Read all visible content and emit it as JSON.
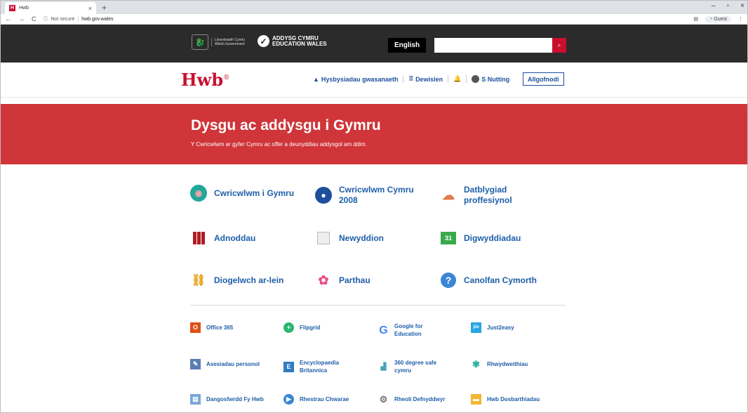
{
  "browser": {
    "tab_title": "Hwb",
    "tab_close": "×",
    "new_tab": "+",
    "security": "Not secure",
    "url": "hwb.gov.wales",
    "profile": "Guest"
  },
  "govbar": {
    "gov_line1": "Llywodraeth Cymru",
    "gov_line2": "Welsh Government",
    "edu_line1": "ADDYSG CYMRU",
    "edu_line2": "EDUCATION WALES",
    "language_button": "English",
    "search_placeholder": ""
  },
  "hwb": {
    "logo": "Hwb",
    "nav": {
      "notices": "Hysbysiadau gwasanaeth",
      "menu": "Dewislen",
      "user": "S Nutting",
      "logout": "Allgofnodi"
    }
  },
  "hero": {
    "title": "Dysgu ac addysgu i Gymru",
    "subtitle": "Y Cwricwlwm ar gyfer Cymru ac offer a deunyddiau addysgol am ddim."
  },
  "tiles": [
    {
      "label": "Cwricwlwm i Gymru",
      "icon": "brain-icon"
    },
    {
      "label": "Cwricwlwm Cymru 2008",
      "icon": "lightbulb-icon"
    },
    {
      "label": "Datblygiad proffesiynol",
      "icon": "cloud-ladder-icon"
    },
    {
      "label": "Adnoddau",
      "icon": "books-icon"
    },
    {
      "label": "Newyddion",
      "icon": "newspaper-icon"
    },
    {
      "label": "Digwyddiadau",
      "icon": "calendar-icon"
    },
    {
      "label": "Diogelwch ar-lein",
      "icon": "safety-icon"
    },
    {
      "label": "Parthau",
      "icon": "pinwheel-icon"
    },
    {
      "label": "Canolfan Cymorth",
      "icon": "help-icon"
    }
  ],
  "calendar_day": "31",
  "tools": [
    {
      "label": "Office 365",
      "icon": "office-icon"
    },
    {
      "label": "Flipgrid",
      "icon": "flipgrid-icon"
    },
    {
      "label": "Google for Education",
      "icon": "google-icon"
    },
    {
      "label": "Just2easy",
      "icon": "j2e-icon"
    },
    {
      "label": "Asesiadau personol",
      "icon": "assessment-icon"
    },
    {
      "label": "Encyclopaedia Britannica",
      "icon": "britannica-icon"
    },
    {
      "label": "360 degree safe cymru",
      "icon": "360-safe-icon"
    },
    {
      "label": "Rhwydweithiau",
      "icon": "network-icon"
    },
    {
      "label": "Dangosfwrdd Fy Hwb",
      "icon": "dashboard-icon"
    },
    {
      "label": "Rhestrau Chwarae",
      "icon": "playlist-icon"
    },
    {
      "label": "Rheoli Defnyddwyr",
      "icon": "gear-icon"
    },
    {
      "label": "Hwb Dosbarthiadau",
      "icon": "folder-icon"
    }
  ]
}
